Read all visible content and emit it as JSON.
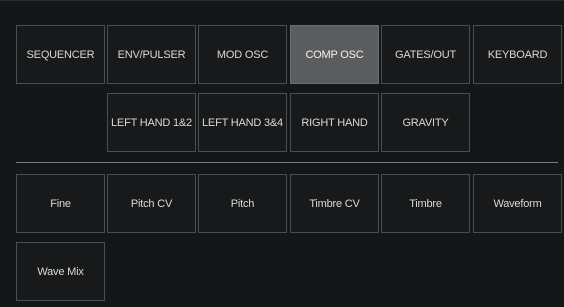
{
  "tabs": [
    {
      "label": "SEQUENCER",
      "active": false
    },
    {
      "label": "ENV/PULSER",
      "active": false
    },
    {
      "label": "MOD OSC",
      "active": false
    },
    {
      "label": "COMP OSC",
      "active": true
    },
    {
      "label": "GATES/OUT",
      "active": false
    },
    {
      "label": "KEYBOARD",
      "active": false
    }
  ],
  "subtabs": [
    {
      "label": "LEFT HAND 1&2"
    },
    {
      "label": "LEFT HAND 3&4"
    },
    {
      "label": "RIGHT HAND"
    },
    {
      "label": "GRAVITY"
    }
  ],
  "parameters": [
    {
      "label": "Fine"
    },
    {
      "label": "Pitch CV"
    },
    {
      "label": "Pitch"
    },
    {
      "label": "Timbre CV"
    },
    {
      "label": "Timbre"
    },
    {
      "label": "Waveform"
    },
    {
      "label": "Wave Mix"
    }
  ],
  "colors": {
    "background": "#151617",
    "button_border": "#4b4d4f",
    "active_button": "#5a5c5e",
    "text": "#d9d9d9"
  }
}
